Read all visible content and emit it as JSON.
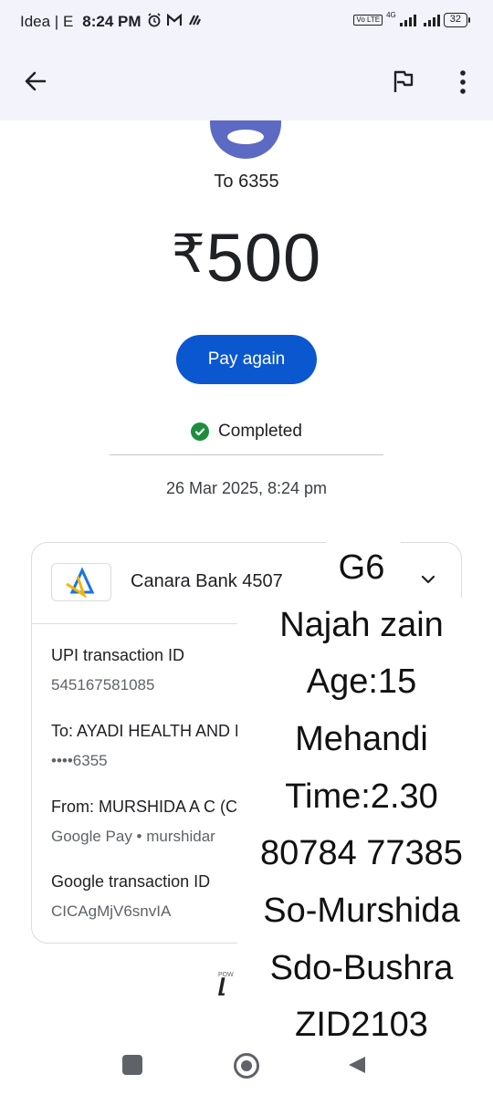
{
  "status_bar": {
    "carrier": "Idea | E",
    "time": "8:24 PM",
    "network_badge": "4G",
    "volte_badge": "Vo LTE",
    "battery": "32",
    "icons": [
      "alarm-icon",
      "gmail-icon",
      "app-notification-icon"
    ]
  },
  "app_bar": {
    "icons": [
      "back-arrow-icon",
      "flag-icon",
      "more-vert-icon"
    ]
  },
  "payment": {
    "recipient": "To 6355",
    "currency_symbol": "₹",
    "amount": "500",
    "pay_again_label": "Pay again",
    "status": "Completed",
    "datetime": "26 Mar 2025, 8:24 pm"
  },
  "details": {
    "bank_name": "Canara Bank 4507",
    "rows": [
      {
        "label": "UPI transaction ID",
        "value": "545167581085"
      },
      {
        "label": "To: AYADI HEALTH AND ED",
        "value": "••••6355"
      },
      {
        "label": "From: MURSHIDA A C (Car",
        "value": "Google Pay • murshidar"
      },
      {
        "label": "Google transaction ID",
        "value": "CICAgMjV6snvIA"
      }
    ],
    "powered_text": "POW"
  },
  "note": {
    "lines": [
      "G6",
      "Najah zain",
      "Age:15",
      "Mehandi",
      "Time:2.30",
      "80784 77385",
      "So-Murshida",
      "Sdo-Bushra",
      "ZID2103"
    ]
  },
  "colors": {
    "primary_button": "#0b57d0",
    "avatar": "#5c6ac4",
    "completed_green": "#1e8e3e",
    "app_bar_bg": "#f2f3fb"
  }
}
